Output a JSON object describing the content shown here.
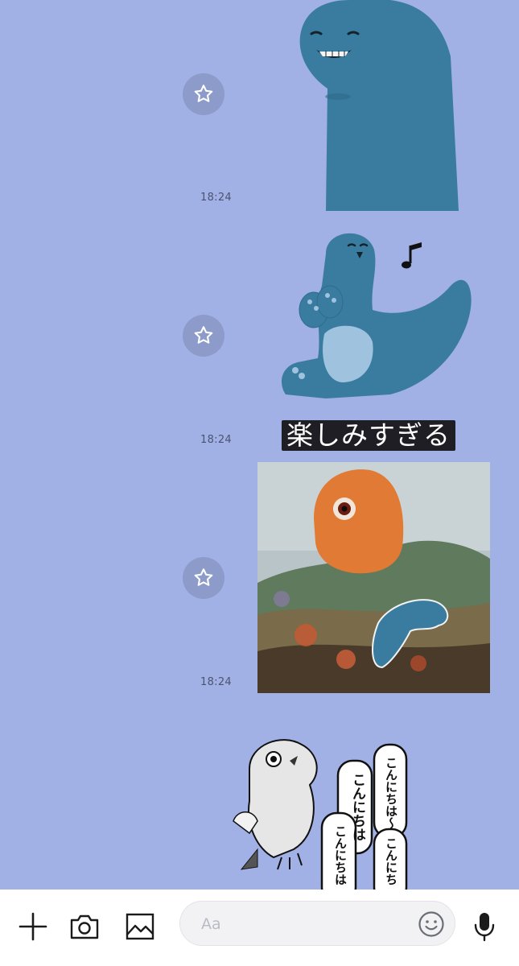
{
  "messages": [
    {
      "time": "18:24",
      "sticker": "smiling-dino-sticker"
    },
    {
      "time": "18:24",
      "sticker": "dancing-dino-sticker",
      "caption": "楽しみすぎる"
    },
    {
      "time": "18:24",
      "sticker": "cyclops-painting-sticker"
    }
  ],
  "partial_sticker": {
    "bubbles": [
      "こんにちは〜",
      "こんにちは",
      "こんにちは",
      "こんにち"
    ]
  },
  "composer": {
    "placeholder": "Aa"
  },
  "colors": {
    "background": "#a1b1e5",
    "dino": "#3a7ca0",
    "star_circle": "#8c9bc9"
  },
  "icons": [
    "star-icon",
    "plus-icon",
    "camera-icon",
    "image-icon",
    "emoji-icon",
    "microphone-icon"
  ]
}
